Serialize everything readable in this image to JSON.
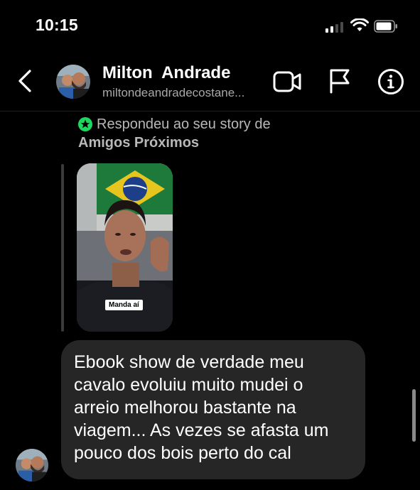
{
  "status_bar": {
    "time": "10:15"
  },
  "header": {
    "name": "Milton  Andrade",
    "username": "miltondeandradecostane..."
  },
  "story_reply": {
    "line1": "Respondeu ao seu story de",
    "line2": "Amigos Próximos",
    "sticker": "Manda aí"
  },
  "message": {
    "lines": [
      "Ebook show de verdade meu",
      "cavalo evoluiu muito mudei o",
      "arreio melhorou bastante na",
      "viagem... As vezes se afasta um",
      "pouco dos bois perto do cal"
    ]
  },
  "icons": {
    "back": "chevron-left-icon",
    "video": "video-camera-icon",
    "flag": "flag-icon",
    "info": "info-icon",
    "close_friends": "star-icon",
    "signal": "signal-icon",
    "wifi": "wifi-icon",
    "battery": "battery-icon"
  },
  "colors": {
    "background": "#000000",
    "bubble": "#262626",
    "close_friends_green": "#1ed760",
    "secondary_text": "#a8a8a8"
  }
}
